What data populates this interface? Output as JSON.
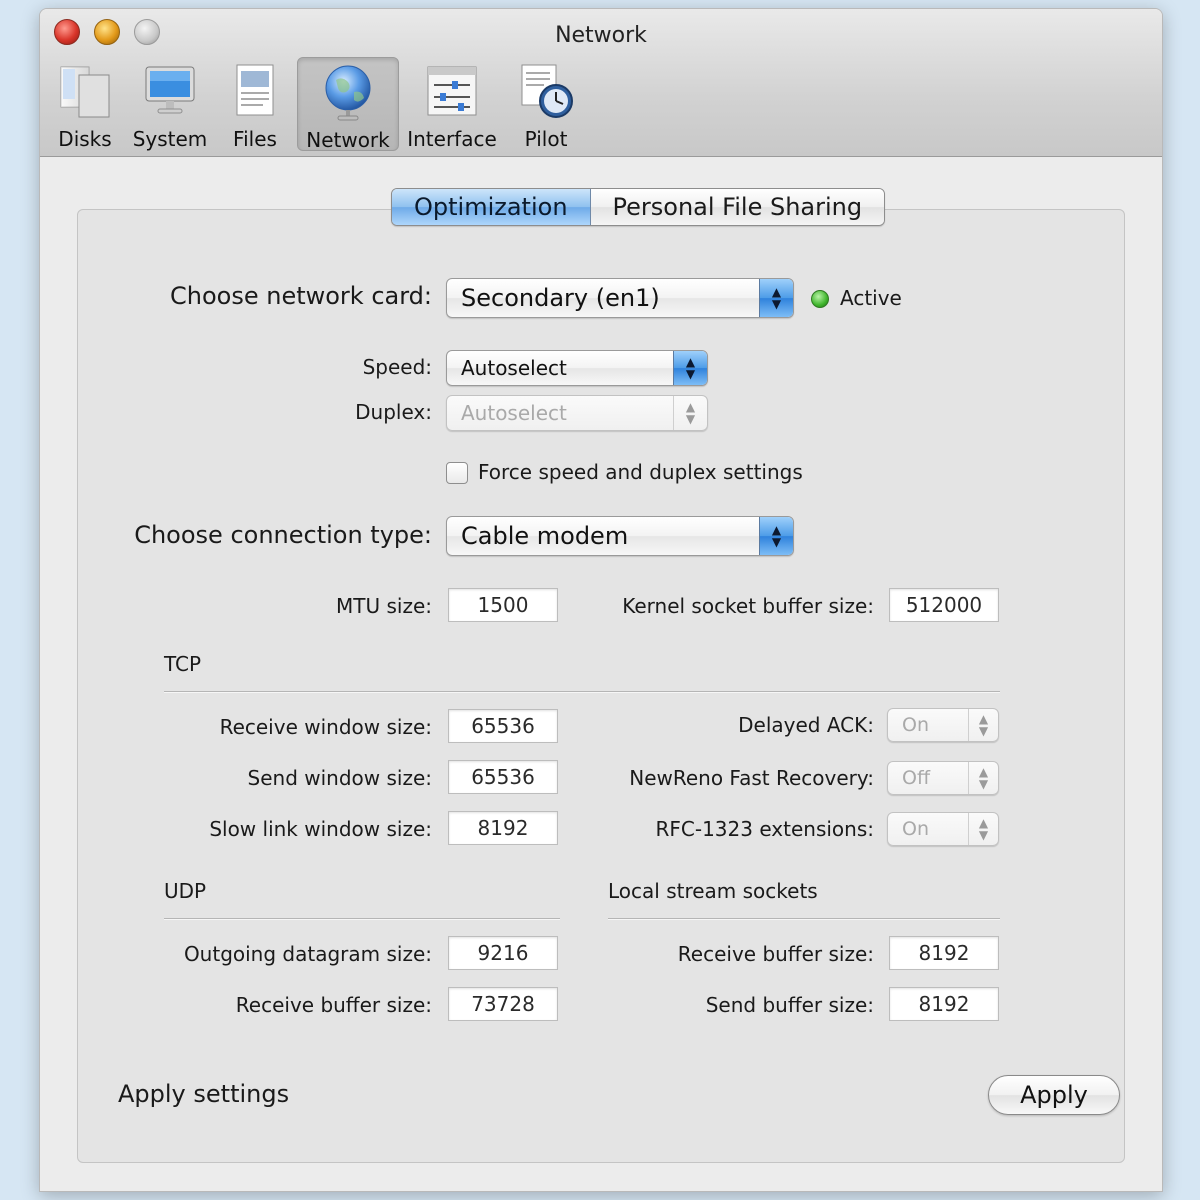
{
  "window": {
    "title": "Network"
  },
  "toolbar": [
    {
      "label": "Disks",
      "icon": "disks-icon"
    },
    {
      "label": "System",
      "icon": "monitor-icon"
    },
    {
      "label": "Files",
      "icon": "files-icon"
    },
    {
      "label": "Network",
      "icon": "globe-icon",
      "selected": true
    },
    {
      "label": "Interface",
      "icon": "sliders-icon"
    },
    {
      "label": "Pilot",
      "icon": "clock-icon"
    }
  ],
  "tabs": {
    "active": "Optimization",
    "inactive": "Personal File Sharing"
  },
  "network_card": {
    "label": "Choose network card:",
    "value": "Secondary (en1)",
    "status": "Active",
    "status_color": "#3fb52c"
  },
  "speed": {
    "label": "Speed:",
    "value": "Autoselect"
  },
  "duplex": {
    "label": "Duplex:",
    "value": "Autoselect"
  },
  "force_checkbox": {
    "label": "Force speed and duplex settings",
    "checked": false
  },
  "connection_type": {
    "label": "Choose connection type:",
    "value": "Cable modem"
  },
  "mtu": {
    "label": "MTU size:",
    "value": "1500"
  },
  "kernel_buffer": {
    "label": "Kernel socket buffer size:",
    "value": "512000"
  },
  "tcp": {
    "title": "TCP",
    "receive_window": {
      "label": "Receive window size:",
      "value": "65536"
    },
    "send_window": {
      "label": "Send window size:",
      "value": "65536"
    },
    "slow_link_window": {
      "label": "Slow link window size:",
      "value": "8192"
    },
    "delayed_ack": {
      "label": "Delayed ACK:",
      "value": "On"
    },
    "newreno": {
      "label": "NewReno Fast Recovery:",
      "value": "Off"
    },
    "rfc1323": {
      "label": "RFC-1323 extensions:",
      "value": "On"
    }
  },
  "udp": {
    "title": "UDP",
    "outgoing_datagram": {
      "label": "Outgoing datagram size:",
      "value": "9216"
    },
    "receive_buffer": {
      "label": "Receive buffer size:",
      "value": "73728"
    }
  },
  "local_stream": {
    "title": "Local stream sockets",
    "receive_buffer": {
      "label": "Receive buffer size:",
      "value": "8192"
    },
    "send_buffer": {
      "label": "Send buffer size:",
      "value": "8192"
    }
  },
  "apply": {
    "section_label": "Apply settings",
    "button_label": "Apply"
  }
}
